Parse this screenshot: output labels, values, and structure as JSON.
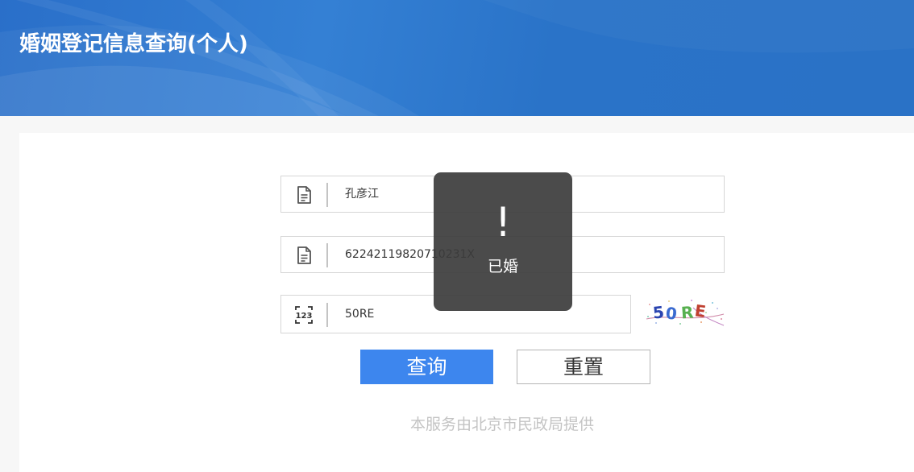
{
  "header": {
    "title": "婚姻登记信息查询(个人)"
  },
  "form": {
    "name_value": "孔彦江",
    "id_value": "62242119820710231X",
    "captcha_value": "50RE",
    "captcha_image_text": "50RE"
  },
  "buttons": {
    "query_label": "查询",
    "reset_label": "重置"
  },
  "footer": {
    "note": "本服务由北京市民政局提供"
  },
  "toast": {
    "mark": "!",
    "message": "已婚"
  },
  "colors": {
    "header_blue": "#2a72c6",
    "query_button": "#3d86ee",
    "toast_bg": "#3c3c3c",
    "footer_text": "#c4c4c4"
  },
  "icons": {
    "name_field": "document-icon",
    "id_field": "document-icon",
    "captcha_field": "number-123-icon"
  }
}
